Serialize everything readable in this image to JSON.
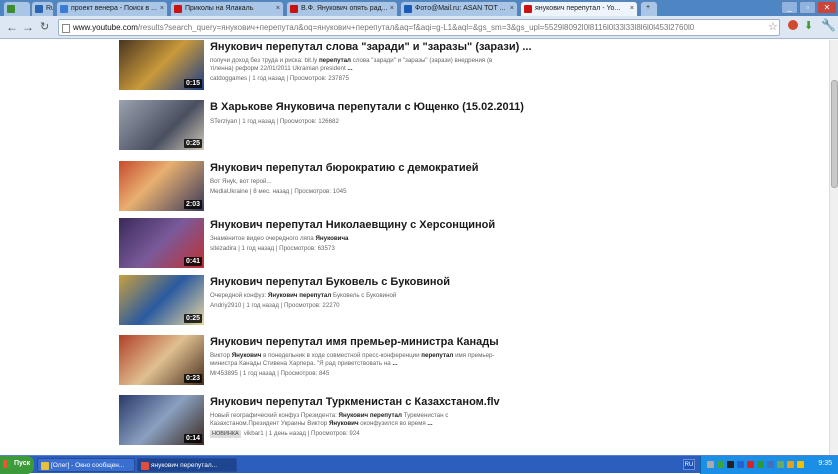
{
  "browser": {
    "tabs": [
      {
        "label": "",
        "icon": "chrome-apps-icon",
        "color": "#3d8f2e"
      },
      {
        "label": "Ru",
        "icon": "ru-icon",
        "color": "#2a64b4"
      },
      {
        "label": "проект венера - Поиск в ...",
        "icon": "search-icon",
        "color": "#3b7bd4"
      },
      {
        "label": "Приколы на Ялакаль",
        "icon": "youtube-icon",
        "color": "#cc1111"
      },
      {
        "label": "В.Ф. Янукович опять рад...",
        "icon": "youtube-icon",
        "color": "#cc1111"
      },
      {
        "label": "Фото@Mail.ru: АSАN ТОТ ...",
        "icon": "mail-icon",
        "color": "#1a5bb8"
      },
      {
        "label": "янукович перепутал - Yo...",
        "icon": "youtube-icon",
        "color": "#cc1111"
      }
    ],
    "new_tab_label": "+",
    "window_buttons": [
      "_",
      "▫",
      "✕"
    ],
    "url_host": "www.youtube.com",
    "url_rest": "/results?search_query=янукович+перепутал&oq=янукович+перепутал&aq=f&aqi=g-L1&aql=&gs_sm=3&gs_upl=5529l8092l0l8116l0l33l33l8l6l0l453l2760l0"
  },
  "results": [
    {
      "title": "Янукович перепутал слова \"заради\" и \"заразы\" (зарази) ...",
      "desc_html": "получи доход без труда и риска: bit.ly <b>перепутал</b> слова \"заради\" и \"заразы\" (зарази) внедрения (в тіленна) реформ 22/01/2011 Ukrainian president <b>...</b>",
      "meta": "catdoggames | 1 год назад | Просмотров: 237875",
      "duration": "0:15",
      "badge": ""
    },
    {
      "title": "В Харькове Януковича перепутали с Ющенко (15.02.2011)",
      "desc_html": "",
      "meta": "STerziyan | 1 год назад | Просмотров: 126682",
      "duration": "0:25",
      "badge": ""
    },
    {
      "title": "Янукович перепутал бюрократию с демократией",
      "desc_html": "Вот Януk, вот герой...",
      "meta": "MediaUkraine | 8 мес. назад | Просмотров: 1045",
      "duration": "2:03",
      "badge": ""
    },
    {
      "title": "Янукович перепутал Николаевщину с Херсонщиной",
      "desc_html": "Знаменитое видео очередного ляпа <b>Януковича</b>",
      "meta": "sitezadira | 1 год назад | Просмотров: 63573",
      "duration": "0:41",
      "badge": ""
    },
    {
      "title": "Янукович перепутал Буковель с Буковиной",
      "desc_html": "Очередной конфуз: <b>Янукович перепутал</b> Буковель с Буковиной",
      "meta": "Andriy2910 | 1 год назад | Просмотров: 22270",
      "duration": "0:25",
      "badge": ""
    },
    {
      "title": "Янукович перепутал имя премьер-министра Канады",
      "desc_html": "Виктор <b>Янукович</b> в понедельник в ходе совместной пресс-конференции <b>перепутал</b> имя премьер-министра Канады Стивена Харпера. \"Я рад приветствовать на <b>...</b>",
      "meta": "Mr453895 | 1 год назад | Просмотров: 845",
      "duration": "0:23",
      "badge": ""
    },
    {
      "title": "Янукович перепутал Туркменистан с Казахстаном.flv",
      "desc_html": "Новый географический конфуз Президента: <b>Янукович перепутал</b> Туркменистан с Казахстаном.Президент Украины Виктор <b>Янукович</b> оконфузился во время <b>...</b>",
      "meta": "vikbar1 | 1 день назад | Просмотров: 924",
      "duration": "0:14",
      "badge": "НОВИНКА"
    }
  ],
  "taskbar": {
    "start_label": "Пуск",
    "tasks": [
      {
        "label": "[Олег] - Окно сообщен...",
        "active": false,
        "color": "#e8c040"
      },
      {
        "label": "янукович перепутал...",
        "active": true,
        "color": "#e24c3c"
      }
    ],
    "lang": "RU",
    "clock": "9:35"
  }
}
